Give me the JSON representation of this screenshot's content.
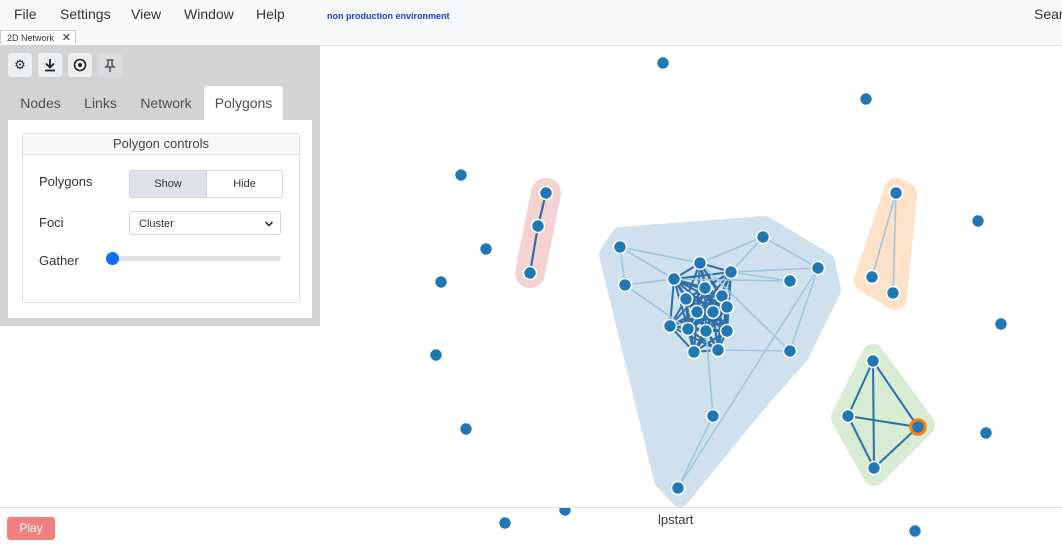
{
  "menu": [
    "File",
    "Settings",
    "View",
    "Window",
    "Help"
  ],
  "environment_label": "non production environment",
  "search_label": "Search",
  "doc_tab": {
    "label": "2D Network",
    "close": "✕"
  },
  "toolbar": {
    "settings_icon": "gear-icon",
    "download_icon": "download-icon",
    "target_icon": "target-icon",
    "pin_icon": "pin-icon"
  },
  "tabs": [
    "Nodes",
    "Links",
    "Network",
    "Polygons"
  ],
  "active_tab": "Polygons",
  "polygon_controls": {
    "title": "Polygon controls",
    "polygons_label": "Polygons",
    "show_label": "Show",
    "hide_label": "Hide",
    "selected": "Show",
    "foci_label": "Foci",
    "foci_value": "Cluster",
    "gather_label": "Gather",
    "gather_value": 0
  },
  "footer": {
    "play_label": "Play",
    "node_label": "lpstart"
  },
  "colors": {
    "node": "#1f77b4",
    "highlight": "#ff7f0e",
    "blue_hull": "#cfe1ef",
    "red_hull": "#f5d3d3",
    "orange_hull": "#fde1c8",
    "green_hull": "#d7ecd3",
    "play": "#f08080"
  }
}
